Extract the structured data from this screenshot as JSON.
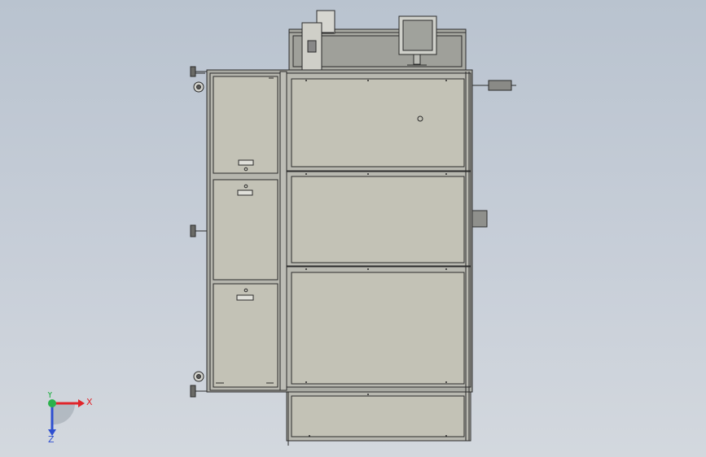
{
  "view": {
    "background_top": "#b9c3cf",
    "background_bottom": "#d3d8de"
  },
  "triad": {
    "x_label": "X",
    "y_label": "Y",
    "z_label": "Z",
    "x_color": "#e0242a",
    "y_color": "#2bb24c",
    "z_color": "#2e4fd0"
  },
  "model": {
    "panel_fill": "#c3c2b6",
    "frame_fill": "#a9aaa3",
    "line_color": "#2b2b2b",
    "left_drawers": [
      "upper-drawer",
      "middle-drawer",
      "lower-drawer"
    ],
    "right_panels": [
      "panel-1",
      "panel-2",
      "panel-3",
      "panel-4"
    ],
    "top_items": [
      "monitor",
      "control-arm"
    ],
    "side_items": [
      "cable-gland",
      "side-fitting"
    ],
    "feet": [
      "foot-top",
      "foot-mid",
      "foot-bottom"
    ],
    "casters": [
      "caster-top",
      "caster-bottom"
    ]
  }
}
